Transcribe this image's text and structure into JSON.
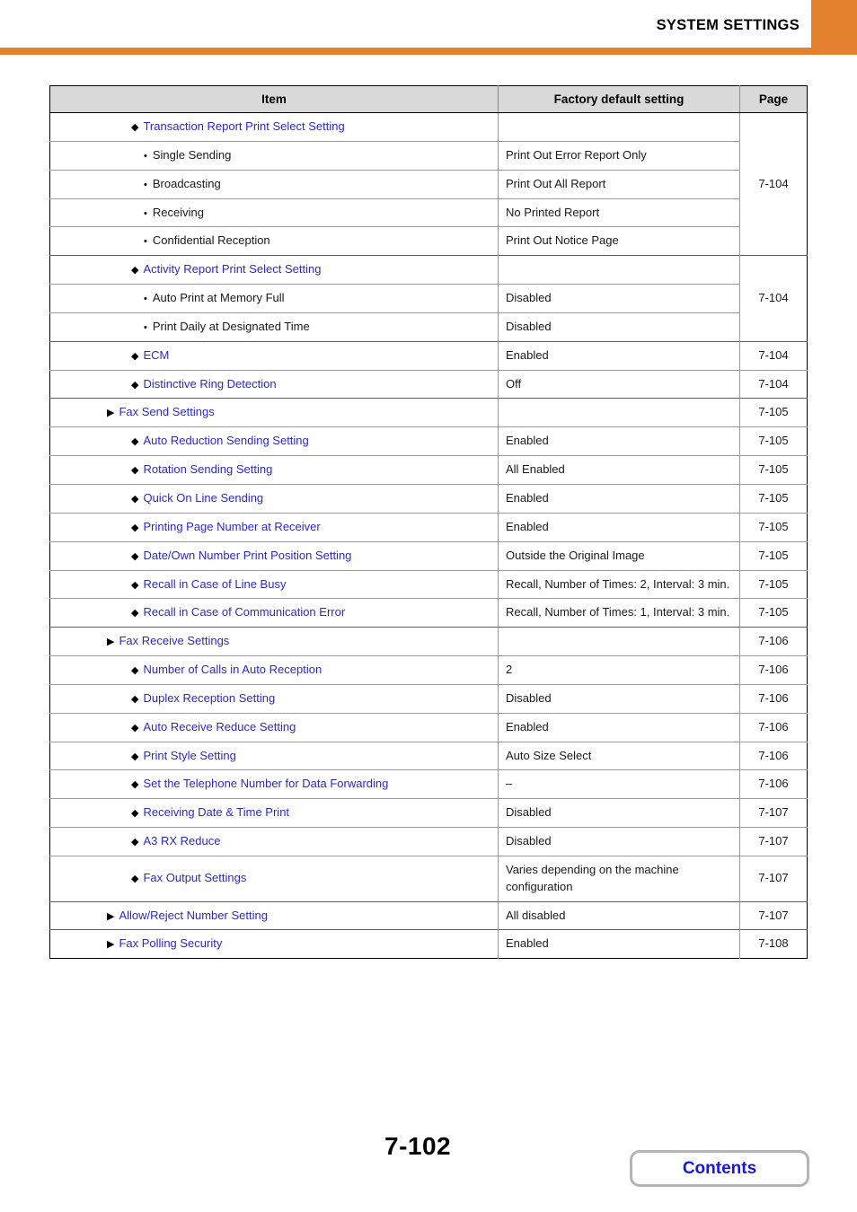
{
  "header": {
    "title": "SYSTEM SETTINGS",
    "accent_color": "#e4812f"
  },
  "table": {
    "columns": {
      "item": "Item",
      "value": "Factory default setting",
      "page": "Page"
    },
    "link_color": "#2a2ac8",
    "rows": [
      {
        "marker": "diamond",
        "level": 2,
        "label": "Transaction Report Print Select Setting",
        "value": "",
        "page": "7-104",
        "page_rowspan": 5,
        "group_start": true
      },
      {
        "marker": "bullet",
        "level": 3,
        "label": "Single Sending",
        "value": "Print Out Error Report Only",
        "page": null
      },
      {
        "marker": "bullet",
        "level": 3,
        "label": "Broadcasting",
        "value": "Print Out All Report",
        "page": null
      },
      {
        "marker": "bullet",
        "level": 3,
        "label": "Receiving",
        "value": "No Printed Report",
        "page": null
      },
      {
        "marker": "bullet",
        "level": 3,
        "label": "Confidential Reception",
        "value": "Print Out Notice Page",
        "page": null
      },
      {
        "marker": "diamond",
        "level": 2,
        "label": "Activity Report Print Select Setting",
        "value": "",
        "page": "7-104",
        "page_rowspan": 3,
        "group_start": true
      },
      {
        "marker": "bullet",
        "level": 3,
        "label": "Auto Print at Memory Full",
        "value": "Disabled",
        "page": null
      },
      {
        "marker": "bullet",
        "level": 3,
        "label": "Print Daily at Designated Time",
        "value": "Disabled",
        "page": null
      },
      {
        "marker": "diamond",
        "level": 2,
        "label": "ECM",
        "value": "Enabled",
        "page": "7-104",
        "page_rowspan": 1,
        "group_start": true
      },
      {
        "marker": "diamond",
        "level": 2,
        "label": "Distinctive Ring Detection",
        "value": "Off",
        "page": "7-104",
        "page_rowspan": 1
      },
      {
        "marker": "triangle",
        "level": 1,
        "label": "Fax Send Settings",
        "value": "",
        "page": "7-105",
        "page_rowspan": 1,
        "group_start": true
      },
      {
        "marker": "diamond",
        "level": 2,
        "label": "Auto Reduction Sending Setting",
        "value": "Enabled",
        "page": "7-105",
        "page_rowspan": 1
      },
      {
        "marker": "diamond",
        "level": 2,
        "label": "Rotation Sending Setting",
        "value": "All Enabled",
        "page": "7-105",
        "page_rowspan": 1
      },
      {
        "marker": "diamond",
        "level": 2,
        "label": "Quick On Line Sending",
        "value": "Enabled",
        "page": "7-105",
        "page_rowspan": 1
      },
      {
        "marker": "diamond",
        "level": 2,
        "label": "Printing Page Number at Receiver",
        "value": "Enabled",
        "page": "7-105",
        "page_rowspan": 1
      },
      {
        "marker": "diamond",
        "level": 2,
        "label": "Date/Own Number Print Position Setting",
        "value": "Outside the Original Image",
        "page": "7-105",
        "page_rowspan": 1
      },
      {
        "marker": "diamond",
        "level": 2,
        "label": "Recall in Case of Line Busy",
        "value": "Recall, Number of Times: 2, Interval: 3 min.",
        "page": "7-105",
        "page_rowspan": 1
      },
      {
        "marker": "diamond",
        "level": 2,
        "label": "Recall in Case of Communication Error",
        "value": "Recall, Number of Times: 1, Interval: 3 min.",
        "page": "7-105",
        "page_rowspan": 1
      },
      {
        "marker": "triangle",
        "level": 1,
        "label": "Fax Receive Settings",
        "value": "",
        "page": "7-106",
        "page_rowspan": 1,
        "group_start": true
      },
      {
        "marker": "diamond",
        "level": 2,
        "label": "Number of Calls in Auto Reception",
        "value": "2",
        "page": "7-106",
        "page_rowspan": 1
      },
      {
        "marker": "diamond",
        "level": 2,
        "label": "Duplex Reception Setting",
        "value": "Disabled",
        "page": "7-106",
        "page_rowspan": 1
      },
      {
        "marker": "diamond",
        "level": 2,
        "label": "Auto Receive Reduce Setting",
        "value": "Enabled",
        "page": "7-106",
        "page_rowspan": 1
      },
      {
        "marker": "diamond",
        "level": 2,
        "label": "Print Style Setting",
        "value": "Auto Size Select",
        "page": "7-106",
        "page_rowspan": 1
      },
      {
        "marker": "diamond",
        "level": 2,
        "label": "Set the Telephone Number for Data Forwarding",
        "value": "–",
        "page": "7-106",
        "page_rowspan": 1
      },
      {
        "marker": "diamond",
        "level": 2,
        "label": "Receiving Date & Time Print",
        "value": "Disabled",
        "page": "7-107",
        "page_rowspan": 1
      },
      {
        "marker": "diamond",
        "level": 2,
        "label": "A3 RX Reduce",
        "value": "Disabled",
        "page": "7-107",
        "page_rowspan": 1
      },
      {
        "marker": "diamond",
        "level": 2,
        "label": "Fax Output Settings",
        "value": "Varies depending on the machine configuration",
        "page": "7-107",
        "page_rowspan": 1
      },
      {
        "marker": "triangle",
        "level": 1,
        "label": "Allow/Reject Number Setting",
        "value": "All disabled",
        "page": "7-107",
        "page_rowspan": 1,
        "group_start": true
      },
      {
        "marker": "triangle",
        "level": 1,
        "label": "Fax Polling Security",
        "value": "Enabled",
        "page": "7-108",
        "page_rowspan": 1,
        "group_start": true
      }
    ]
  },
  "footer": {
    "page_number": "7-102",
    "contents_label": "Contents"
  }
}
